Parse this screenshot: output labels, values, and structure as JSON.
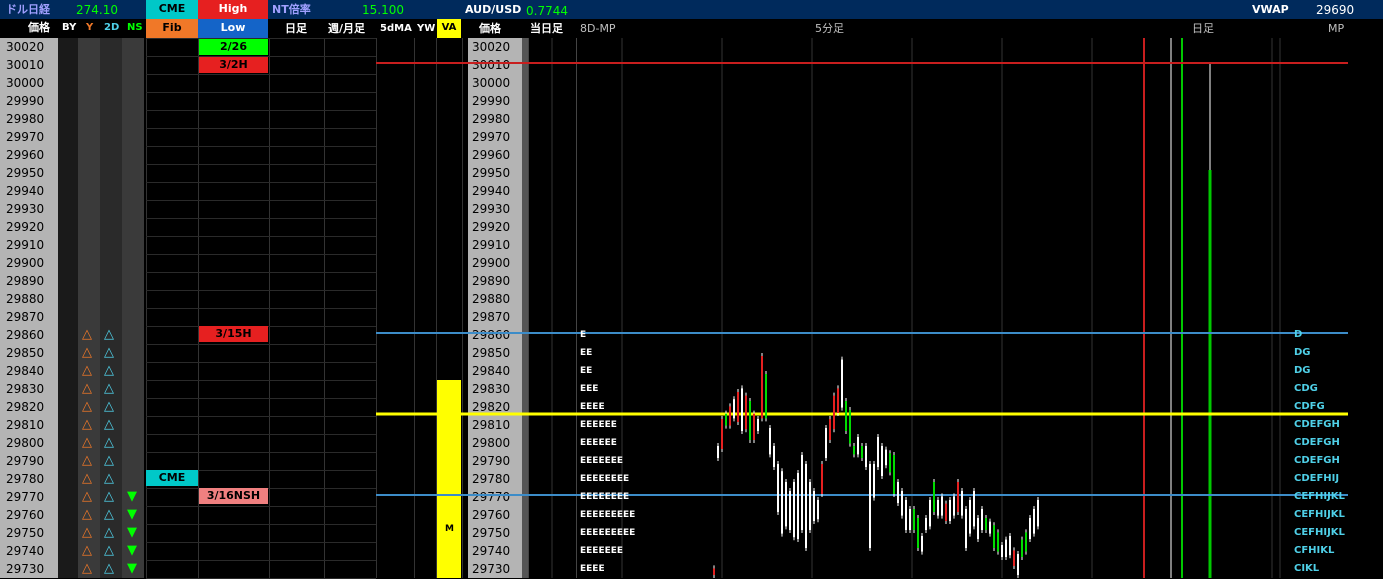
{
  "header": {
    "dollar_nikkei_label": "ドル日経",
    "dollar_nikkei_value": "274.10",
    "cme_label": "CME",
    "high_label": "High",
    "nt_label": "NT倍率",
    "nt_value": "15.100",
    "audusd_label": "AUD/USD",
    "audusd_value": "0.7744",
    "vwap_label": "VWAP",
    "vwap_value": "29690",
    "price_label": "価格",
    "by_label": "BY",
    "y_label": "Y",
    "twod_label": "2D",
    "ns_label": "NS",
    "fib_label": "Fib",
    "low_label": "Low",
    "daily_label": "日足",
    "weekly_monthly_label": "週/月足",
    "fivedma_label": "5dMA",
    "yw_label": "YW",
    "va_label": "VA",
    "price_label2": "価格",
    "today_label": "当日足",
    "eightd_label": "8D-MP",
    "fivemin_label": "5分足",
    "daily_label2": "日足",
    "mp_label": "MP"
  },
  "prices": [
    "30020",
    "30010",
    "30000",
    "29990",
    "29980",
    "29970",
    "29960",
    "29950",
    "29940",
    "29930",
    "29920",
    "29910",
    "29900",
    "29890",
    "29880",
    "29870",
    "29860",
    "29850",
    "29840",
    "29830",
    "29820",
    "29810",
    "29800",
    "29790",
    "29780",
    "29770",
    "29760",
    "29750",
    "29740",
    "29730"
  ],
  "badges": {
    "date_226": "2/26",
    "date_32h": "3/2H",
    "date_315h": "3/15H",
    "cme_marker": "CME",
    "date_316nsh": "3/16NSH",
    "va_marker": "M"
  },
  "eightd_mp": [
    "E",
    "EE",
    "EE",
    "EEE",
    "EEEE",
    "EEEEEE",
    "EEEEEE",
    "EEEEEEE",
    "EEEEEEEE",
    "EEEEEEEE",
    "EEEEEEEEE",
    "EEEEEEEEE",
    "EEEEEEE",
    "EEEE"
  ],
  "mp_letters": [
    "D",
    "DG",
    "DG",
    "CDG",
    "CDFG",
    "CDEFGH",
    "CDEFGH",
    "CDEFGH",
    "CDEFHIJ",
    "CEFHIJKL",
    "CEFHIJKL",
    "CEFHIJKL",
    "CFHIKL",
    "CIKL"
  ],
  "colors": {
    "header_bg": "#002a5c",
    "price_col": "#b4b4b4",
    "high_red": "#e62020",
    "low_blue": "#1464c8",
    "fib_orange": "#f07828",
    "cme_cyan": "#00c8c8",
    "date_green": "#00ff00",
    "va_yellow": "#ffff00",
    "nsh_pink": "#f08080"
  }
}
